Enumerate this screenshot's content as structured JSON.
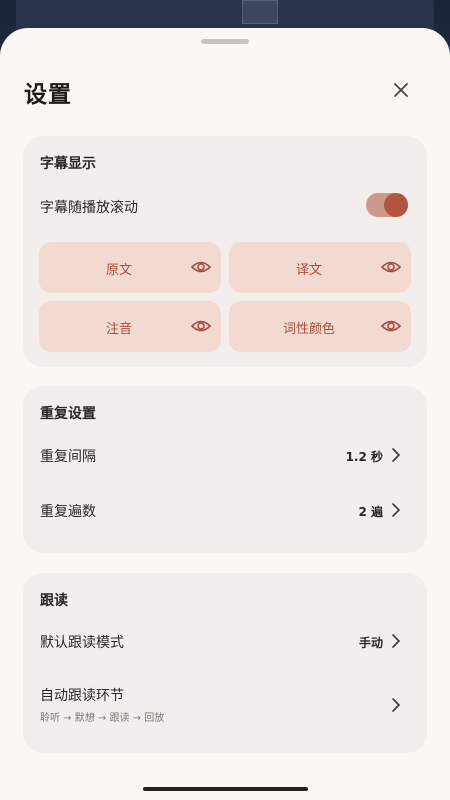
{
  "header": {
    "title": "设置"
  },
  "subtitle_section": {
    "title": "字幕显示",
    "scroll_label": "字幕随播放滚动",
    "scroll_enabled": true,
    "chips": [
      {
        "label": "原文",
        "icon": "eye-icon"
      },
      {
        "label": "译文",
        "icon": "eye-icon"
      },
      {
        "label": "注音",
        "icon": "eye-icon"
      },
      {
        "label": "词性颜色",
        "icon": "eye-icon"
      }
    ]
  },
  "repeat_section": {
    "title": "重复设置",
    "interval_label": "重复间隔",
    "interval_value": "1.2 秒",
    "count_label": "重复遍数",
    "count_value": "2 遍"
  },
  "follow_section": {
    "title": "跟读",
    "mode_label": "默认跟读模式",
    "mode_value": "手动",
    "auto_label": "自动跟读环节",
    "auto_steps": "聆听 → 默想 → 跟读 → 回放"
  },
  "colors": {
    "sheet_bg": "#fbf8f3",
    "card_bg": "#f3eeeb",
    "chip_bg": "#f3dad1",
    "accent": "#b25540",
    "chip_text": "#a44f3d"
  }
}
